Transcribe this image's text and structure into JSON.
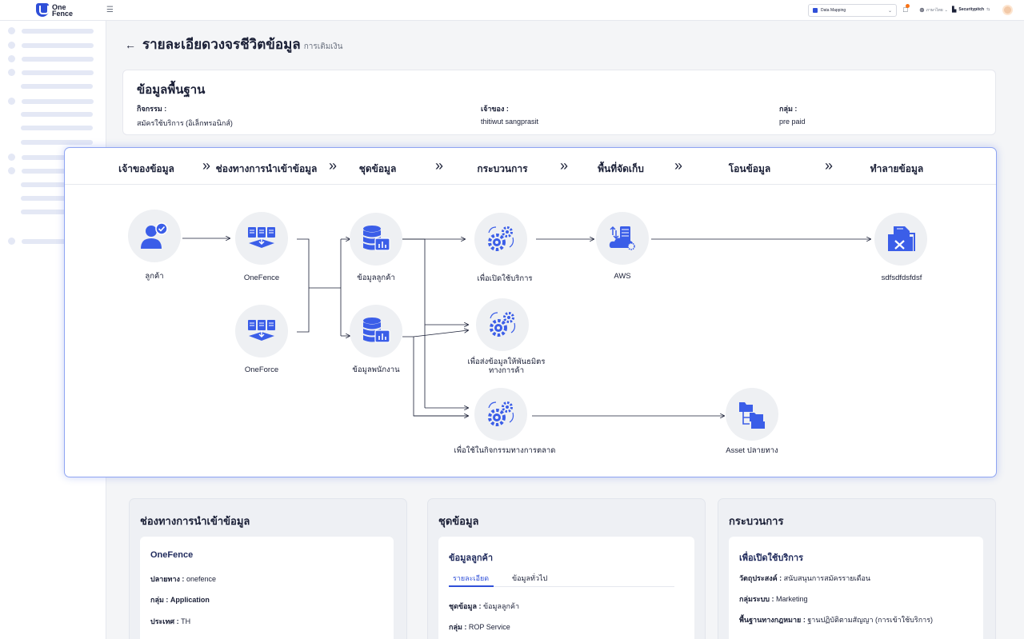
{
  "topbar": {
    "logo_line1": "One",
    "logo_line2": "Fence",
    "module_select": "Data Mapping",
    "language": "ภาษาไทย",
    "organization": "Securitypitch"
  },
  "header": {
    "title": "รายละเอียดวงจรชีวิตข้อมูล",
    "subtitle": "การเติมเงิน"
  },
  "basic_info": {
    "title": "ข้อมูลพื้นฐาน",
    "fields": [
      {
        "label": "กิจกรรม :",
        "value": "สมัครใช้บริการ (อิเล็กทรอนิกส์)"
      },
      {
        "label": "เจ้าของ :",
        "value": "thitiwut sangprasit"
      },
      {
        "label": "กลุ่ม :",
        "value": "pre paid"
      }
    ]
  },
  "flow": {
    "stages": [
      "เจ้าของข้อมูล",
      "ช่องทางการนำเข้าข้อมูล",
      "ชุดข้อมูล",
      "กระบวนการ",
      "พื้นที่จัดเก็บ",
      "โอนข้อมูล",
      "ทำลายข้อมูล"
    ],
    "separator": "»",
    "nodes": {
      "customer": "ลูกค้า",
      "onefence": "OneFence",
      "oneforce": "OneForce",
      "customer_data": "ข้อมูลลูกค้า",
      "employee_data": "ข้อมูลพนักงาน",
      "open_service": "เพื่อเปิดใช้บริการ",
      "send_partner_1": "เพื่อส่งข้อมูลให้พันธมิตร",
      "send_partner_2": "ทางการค้า",
      "marketing": "เพื่อใช้ในกิจกรรมทางการตลาด",
      "aws": "AWS",
      "asset_dest": "Asset ปลายทาง",
      "destroy": "sdfsdfdsfdsf"
    }
  },
  "bottom": {
    "channel": {
      "title": "ช่องทางการนำเข้าข้อมูล",
      "inner_title": "OneFence",
      "rows": [
        {
          "k": "ปลายทาง :",
          "v": " onefence"
        },
        {
          "k": "กลุ่ม : Application",
          "v": ""
        },
        {
          "k": "ประเทศ :",
          "v": " TH"
        }
      ]
    },
    "dataset": {
      "title": "ชุดข้อมูล",
      "inner_title": "ข้อมูลลูกค้า",
      "tab_detail": "รายละเอียด",
      "tab_general": "ข้อมูลทั่วไป",
      "rows": [
        {
          "k": "ชุดข้อมูล :",
          "v": " ข้อมูลลูกค้า"
        },
        {
          "k": "กลุ่ม :",
          "v": " ROP Service"
        }
      ]
    },
    "process": {
      "title": "กระบวนการ",
      "inner_title": "เพื่อเปิดใช้บริการ",
      "rows": [
        {
          "k": "วัตถุประสงค์ :",
          "v": " สนับสนุนการสมัครรายเดือน"
        },
        {
          "k": "กลุ่มระบบ :",
          "v": " Marketing"
        },
        {
          "k": "พื้นฐานทางกฎหมาย :",
          "v": " ฐานปฏิบัติตามสัญญา (การเข้าใช้บริการ)"
        }
      ]
    }
  },
  "colors": {
    "accent": "#2f4fd8",
    "icon_blue": "#3b5ee8",
    "flow_border": "#8ea4f2"
  }
}
